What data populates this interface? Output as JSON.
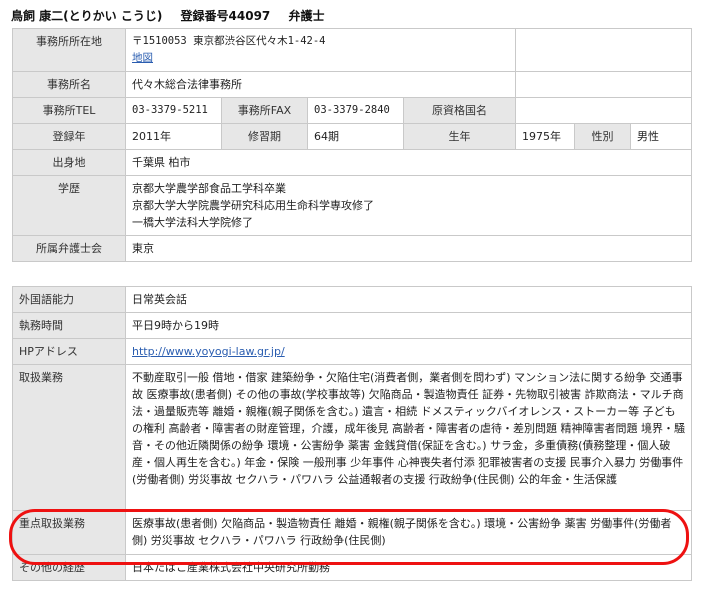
{
  "header": {
    "name": "鳥飼 康二(とりかい こうじ)",
    "reg_number": "登録番号44097",
    "title": "弁護士"
  },
  "basic": {
    "office_address_label": "事務所所在地",
    "office_address_zip": "〒1510053 東京都渋谷区代々木1-42-4",
    "map_link": "地図",
    "office_name_label": "事務所名",
    "office_name": "代々木総合法律事務所",
    "tel_label": "事務所TEL",
    "tel": "03-3379-5211",
    "fax_label": "事務所FAX",
    "fax": "03-3379-2840",
    "original_cert_label": "原資格国名",
    "original_cert": "",
    "reg_year_label": "登録年",
    "reg_year": "2011年",
    "training_label": "修習期",
    "training": "64期",
    "birth_year_label": "生年",
    "birth_year": "1975年",
    "gender_label": "性別",
    "gender": "男性",
    "birthplace_label": "出身地",
    "birthplace": "千葉県 柏市",
    "education_label": "学歴",
    "education": [
      "京都大学農学部食品工学科卒業",
      "京都大学大学院農学研究科応用生命科学専攻修了",
      "一橋大学法科大学院修了"
    ],
    "bar_label": "所属弁護士会",
    "bar": "東京"
  },
  "detail": {
    "languages_label": "外国語能力",
    "languages": "日常英会話",
    "hours_label": "執務時間",
    "hours": "平日9時から19時",
    "hp_label": "HPアドレス",
    "hp": "http://www.yoyogi-law.gr.jp/",
    "practice_label": "取扱業務",
    "practice": "不動産取引一般 借地・借家 建築紛争・欠陥住宅(消費者側，業者側を問わず) マンション法に関する紛争 交通事故 医療事故(患者側) その他の事故(学校事故等) 欠陥商品・製造物責任 証券・先物取引被害 詐欺商法・マルチ商法・過量販売等 離婚・親権(親子関係を含む。) 遺言・相続 ドメスティックバイオレンス・ストーカー等 子どもの権利 高齢者・障害者の財産管理，介護，成年後見 高齢者・障害者の虐待・差別問題 精神障害者問題 境界・騒音・その他近隣関係の紛争 環境・公害紛争 薬害 金銭貸借(保証を含む。) サラ金，多重債務(債務整理・個人破産・個人再生を含む。) 年金・保険 一般刑事 少年事件 心神喪失者付添 犯罪被害者の支援 民事介入暴力 労働事件(労働者側) 労災事故 セクハラ・パワハラ 公益通報者の支援 行政紛争(住民側) 公的年金・生活保護",
    "focus_label": "重点取扱業務",
    "focus": "医療事故(患者側) 欠陥商品・製造物責任 離婚・親権(親子関係を含む。) 環境・公害紛争 薬害 労働事件(労働者側) 労災事故 セクハラ・パワハラ 行政紛争(住民側)",
    "career_label": "その他の経歴",
    "career": "日本たばこ産業株式会社中央研究所勤務"
  }
}
